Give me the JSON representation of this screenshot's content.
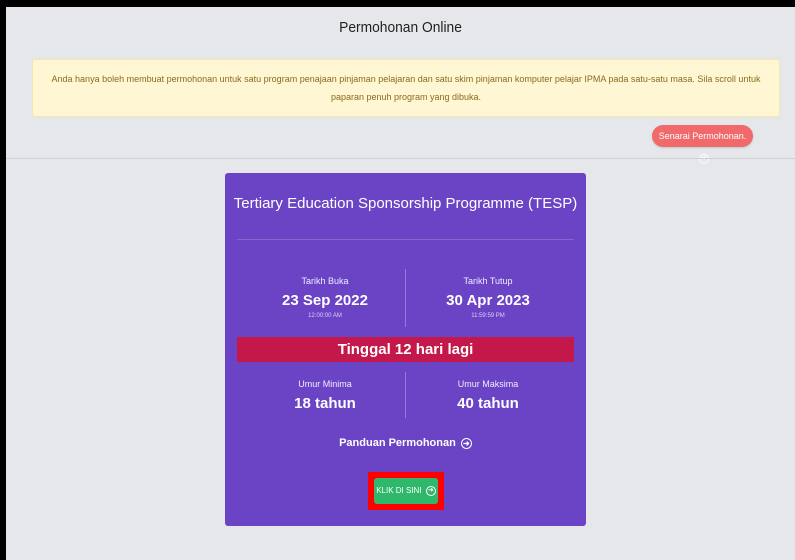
{
  "header": {
    "title": "Permohonan Online"
  },
  "notice": {
    "text": "Anda hanya boleh membuat permohonan untuk satu program penajaan pinjaman pelajaran dan satu skim pinjaman komputer pelajar IPMA pada satu-satu masa. Sila scroll untuk paparan penuh program yang dibuka."
  },
  "list_button": {
    "label": "Senarai Permohonan."
  },
  "program": {
    "title": "Tertiary Education Sponsorship Programme (TESP)",
    "open": {
      "label": "Tarikh Buka",
      "date": "23 Sep 2022",
      "time": "12:00:00 AM"
    },
    "close": {
      "label": "Tarikh Tutup",
      "date": "30 Apr 2023",
      "time": "11:59:59 PM"
    },
    "countdown": "Tinggal 12 hari lagi",
    "min_age": {
      "label": "Umur Minima",
      "value": "18 tahun"
    },
    "max_age": {
      "label": "Umur Maksima",
      "value": "40 tahun"
    },
    "guide_label": "Panduan Permohonan",
    "apply_label": "KLIK DI SINI"
  },
  "icons": {
    "arrow": "arrow-right-circle-icon"
  },
  "colors": {
    "card": "#6b44c6",
    "countdown": "#c4174a",
    "apply": "#2fb86b",
    "list_button": "#f0696b",
    "notice_bg": "#fff6d4",
    "highlight": "#ff0000"
  }
}
